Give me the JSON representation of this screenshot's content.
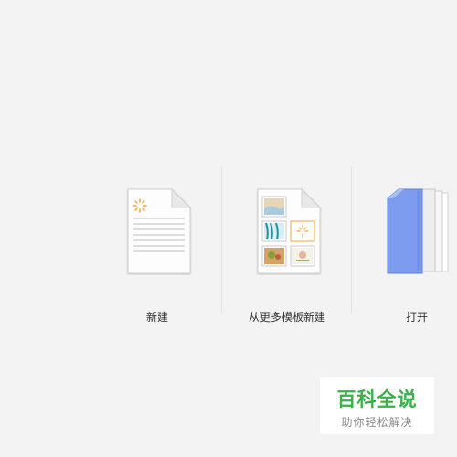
{
  "actions": {
    "new_label": "新建",
    "template_label": "从更多模板新建",
    "open_label": "打开"
  },
  "icons": {
    "new": "blank-document-icon",
    "template": "template-document-icon",
    "open": "folder-icon"
  },
  "watermark": {
    "title": "百科全说",
    "subtitle": "助你轻松解决"
  },
  "colors": {
    "background": "#f3f3f3",
    "divider": "#e2e2e2",
    "folder_blue": "#7d9cf0",
    "sparkle_orange": "#f2a33a",
    "watermark_green": "#38b248"
  }
}
